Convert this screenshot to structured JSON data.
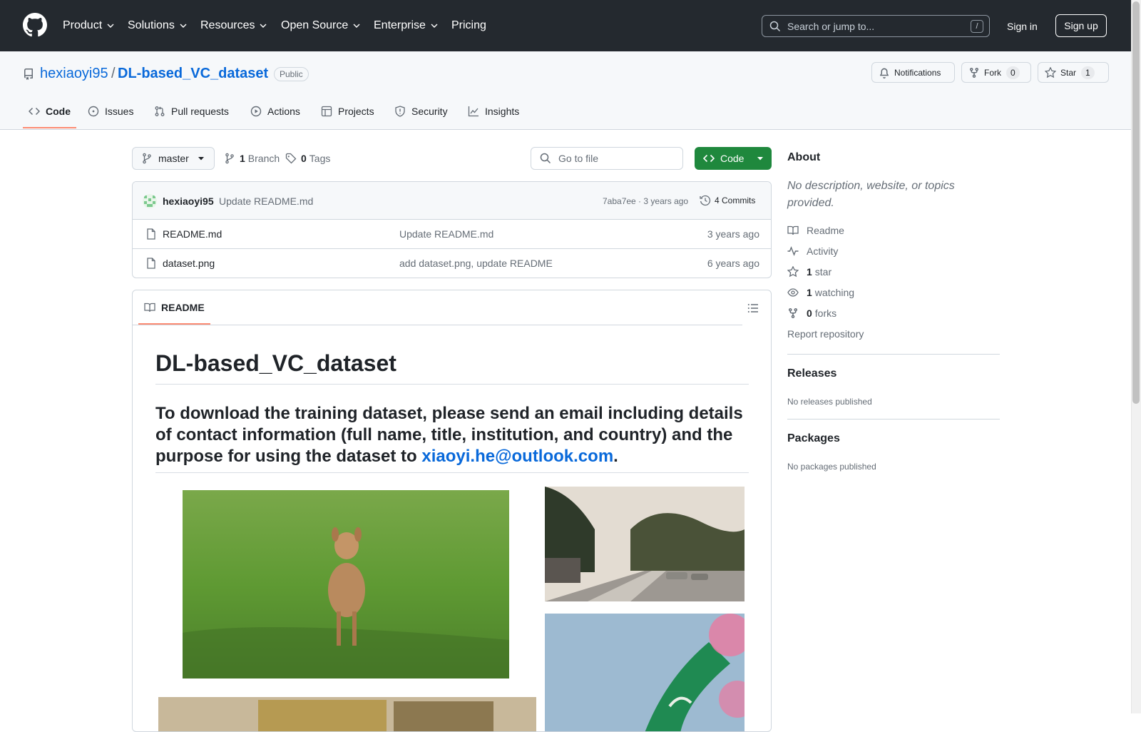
{
  "header": {
    "nav": [
      "Product",
      "Solutions",
      "Resources",
      "Open Source",
      "Enterprise",
      "Pricing"
    ],
    "search_placeholder": "Search or jump to...",
    "search_shortcut": "/",
    "sign_in": "Sign in",
    "sign_up": "Sign up"
  },
  "repo": {
    "owner": "hexiaoyi95",
    "separator": "/",
    "name": "DL-based_VC_dataset",
    "visibility": "Public",
    "notifications_label": "Notifications",
    "fork_label": "Fork",
    "fork_count": "0",
    "star_label": "Star",
    "star_count": "1"
  },
  "tabs": [
    "Code",
    "Issues",
    "Pull requests",
    "Actions",
    "Projects",
    "Security",
    "Insights"
  ],
  "toolbar": {
    "branch": "master",
    "branch_count": "1",
    "branch_label": "Branch",
    "tag_count": "0",
    "tag_label": "Tags",
    "go_to_file": "Go to file",
    "code_button": "Code"
  },
  "latest_commit": {
    "author": "hexiaoyi95",
    "message": "Update README.md",
    "meta": "7aba7ee · 3 years ago",
    "commits": "4 Commits"
  },
  "files": [
    {
      "name": "README.md",
      "message": "Update README.md",
      "time": "3 years ago"
    },
    {
      "name": "dataset.png",
      "message": "add dataset.png, update README",
      "time": "6 years ago"
    }
  ],
  "readme": {
    "tab": "README",
    "title": "DL-based_VC_dataset",
    "lead": "To download the training dataset, please send an email including details of contact information (full name, title, institution, and country) and the purpose for using the dataset to",
    "email": "xiaoyi.he@outlook.com",
    "trail": "."
  },
  "sidebar": {
    "about_title": "About",
    "about_desc": "No description, website, or topics provided.",
    "readme": "Readme",
    "activity": "Activity",
    "stars_count": "1",
    "stars_label": "star",
    "watching_count": "1",
    "watching_label": "watching",
    "forks_count": "0",
    "forks_label": "forks",
    "report": "Report repository",
    "releases_title": "Releases",
    "releases_empty": "No releases published",
    "packages_title": "Packages",
    "packages_empty": "No packages published"
  },
  "colors": {
    "header_bg": "#24292f",
    "link": "#0969da",
    "code_button": "#1f883d",
    "tab_underline": "#fd8c73"
  }
}
